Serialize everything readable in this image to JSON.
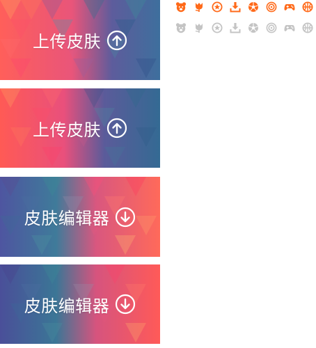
{
  "banners": [
    {
      "label": "上传皮肤",
      "action_icon": "upload-circle-icon"
    },
    {
      "label": "上传皮肤",
      "action_icon": "upload-circle-icon"
    },
    {
      "label": "皮肤编辑器",
      "action_icon": "download-circle-icon"
    },
    {
      "label": "皮肤编辑器",
      "action_icon": "download-circle-icon"
    }
  ],
  "icon_rows": {
    "active_color": "#ff6a1a",
    "inactive_color": "#c4c4c4",
    "icons": [
      "bear-icon",
      "tulip-icon",
      "star-badge-icon",
      "download-tray-icon",
      "soccer-ball-icon",
      "target-icon",
      "gamepad-icon",
      "basketball-icon"
    ]
  },
  "palette": {
    "warm": [
      "#ff6a4d",
      "#ff5a6e",
      "#f9476b",
      "#ff8a5a"
    ],
    "cool": [
      "#4d5fa3",
      "#3f7f9a",
      "#4a6d9e",
      "#5a4f93"
    ]
  }
}
